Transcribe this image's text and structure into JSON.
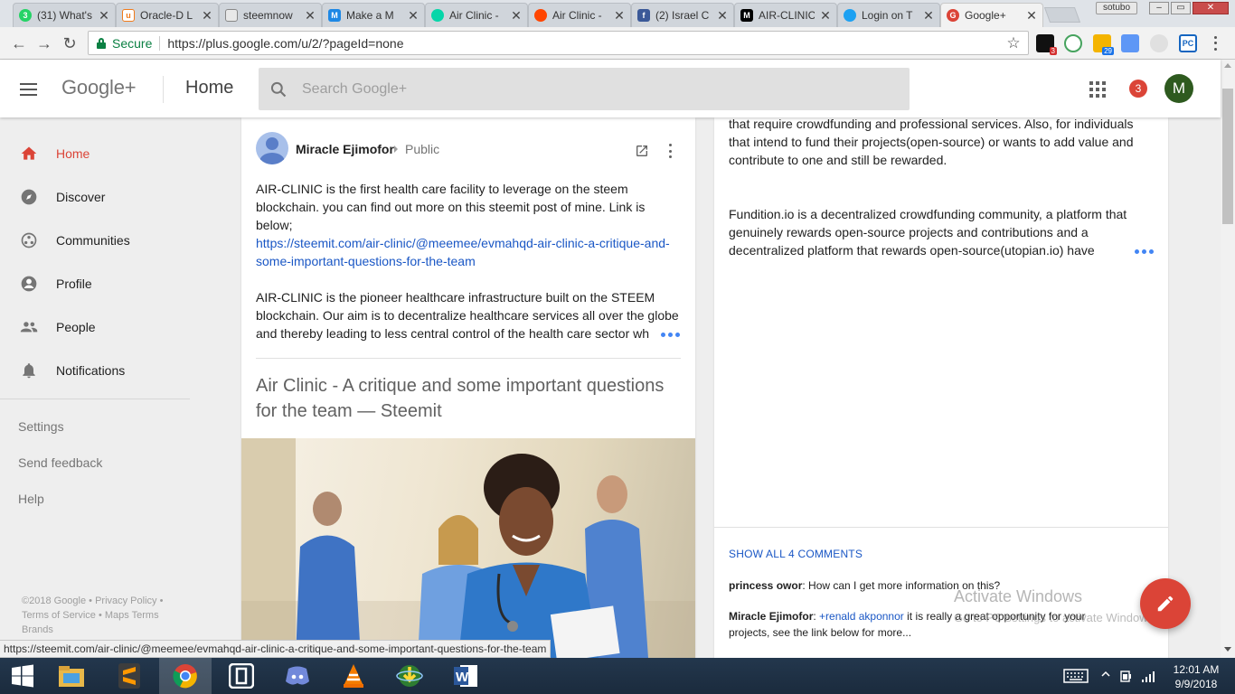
{
  "browser": {
    "tabs": [
      {
        "label": "(31) What's",
        "favicon": "whatsapp-icon",
        "color": "#25d366"
      },
      {
        "label": "Oracle-D L",
        "favicon": "utopian-icon",
        "color": "#ffffff"
      },
      {
        "label": "steemnow",
        "favicon": "page-icon",
        "color": "#888888"
      },
      {
        "label": "Make a M",
        "favicon": "medium-icon",
        "color": "#1e88e5"
      },
      {
        "label": "Air Clinic -",
        "favicon": "steemit-icon",
        "color": "#06d6a9"
      },
      {
        "label": "Air Clinic -",
        "favicon": "reddit-icon",
        "color": "#ff4500"
      },
      {
        "label": "(2) Israel C",
        "favicon": "facebook-icon",
        "color": "#3b5998"
      },
      {
        "label": "AIR-CLINIC",
        "favicon": "medium-m-icon",
        "color": "#000000"
      },
      {
        "label": "Login on T",
        "favicon": "twitter-icon",
        "color": "#1da1f2"
      },
      {
        "label": "Google+",
        "favicon": "google-plus-icon",
        "color": "#db4437"
      }
    ],
    "active_tab": 9,
    "user_badge": "sotubo",
    "secure_label": "Secure",
    "url": "https://plus.google.com/u/2/?pageId=none",
    "extension_badges": [
      "3",
      "29"
    ]
  },
  "header": {
    "logo": "Google+",
    "title": "Home",
    "search_placeholder": "Search Google+",
    "notification_count": "3",
    "avatar_letter": "M",
    "colors": {
      "accent": "#db4437",
      "avatar": "#2e5a1f"
    }
  },
  "sidebar": {
    "items": [
      {
        "label": "Home",
        "icon": "home-icon"
      },
      {
        "label": "Discover",
        "icon": "compass-icon"
      },
      {
        "label": "Communities",
        "icon": "communities-icon"
      },
      {
        "label": "Profile",
        "icon": "profile-icon"
      },
      {
        "label": "People",
        "icon": "people-icon"
      },
      {
        "label": "Notifications",
        "icon": "bell-icon"
      }
    ],
    "secondary": [
      "Settings",
      "Send feedback",
      "Help"
    ],
    "legal": "©2018 Google • Privacy Policy • Terms of Service • Maps Terms Brands"
  },
  "post": {
    "author": "Miracle Ejimofor",
    "audience": "Public",
    "paragraph1": "AIR-CLINIC is the first health care facility to leverage on the steem blockchain. you can find out more on this steemit post of mine. Link is below;",
    "link": "https://steemit.com/air-clinic/@meemee/evmahqd-air-clinic-a-critique-and-some-important-questions-for-the-team",
    "paragraph2": "AIR-CLINIC is the pioneer healthcare infrastructure built on the STEEM blockchain. Our aim is to decentralize healthcare services all over the globe and thereby leading to less central control of the health care sector wh",
    "share_title": "Air Clinic - A critique and some important questions for the team — Steemit"
  },
  "right_panel": {
    "text1": "that require crowdfunding and professional services. Also, for individuals that intend to fund their projects(open-source) or wants to add value and contribute to one and still be rewarded.",
    "text2": "Fundition.io is a decentralized crowdfunding community, a platform that genuinely rewards open-source projects and contributions and a decentralized platform that rewards open-source(utopian.io) have",
    "show_all": "SHOW ALL 4 COMMENTS",
    "comments": [
      {
        "author": "princess owor",
        "text": "How can I get more information on this?"
      },
      {
        "author": "Miracle Ejimofor",
        "mention": "+renald akponnor",
        "text": "it is really a great opportunity for your projects, see the link below for more..."
      }
    ]
  },
  "watermark": {
    "line1": "Activate Windows",
    "line2": "Go to PC settings to activate Windows"
  },
  "status_bar_url": "https://steemit.com/air-clinic/@meemee/evmahqd-air-clinic-a-critique-and-some-important-questions-for-the-team",
  "taskbar": {
    "apps": [
      "start-icon",
      "file-explorer-icon",
      "sublime-text-icon",
      "chrome-icon",
      "app-icon",
      "discord-icon",
      "vlc-icon",
      "internet-download-manager-icon",
      "word-icon"
    ],
    "active_app": 3,
    "time": "12:01 AM",
    "date": "9/9/2018"
  }
}
